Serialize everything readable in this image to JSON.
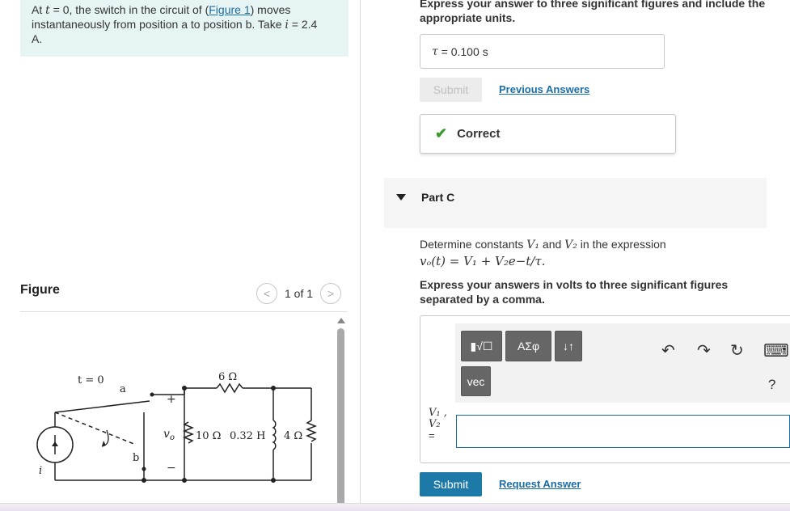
{
  "problem": {
    "p1": "At ",
    "t_var": "t",
    "p2": " = 0, the switch in the circuit of (",
    "link": "Figure 1",
    "p3": ") moves instantaneously from position a to position b. Take ",
    "i_var": "i",
    "p4": " = 2.4",
    "unit": "A."
  },
  "figure": {
    "title": "Figure",
    "pager": "1 of 1",
    "prev": "<",
    "next": ">"
  },
  "circuit": {
    "t_label": "t = 0",
    "a": "a",
    "b": "b",
    "plus": "+",
    "minus": "−",
    "vo": "v",
    "vo_sub": "o",
    "r1": "6 Ω",
    "r2": "10 Ω",
    "l1": "0.32 H",
    "r3": "4 Ω",
    "i": "i"
  },
  "partB": {
    "instruction": "Express your answer to three significant figures and include the appropriate units.",
    "tau_symbol": "τ",
    "eq": " = ",
    "value": "0.100",
    "unit": "s",
    "submit": "Submit",
    "previous": "Previous Answers",
    "correct": "Correct"
  },
  "partC": {
    "label": "Part C",
    "q1": "Determine constants ",
    "v1": "V₁",
    "and": " and ",
    "v2": "V₂",
    "q2": " in the expression",
    "expr": "vₒ(t) = V₁ + V₂e−t/τ.",
    "instruction": "Express your answers in volts to three significant figures separated by a comma.",
    "toolbar": {
      "templates": "▮√☐",
      "greek": "ΑΣφ",
      "arrows": "↓↑",
      "vec": "vec"
    },
    "icons": {
      "undo": "↶",
      "redo": "↷",
      "reset": "↻",
      "keyboard": "⌨",
      "help": "?"
    },
    "var1": "V₁ ,",
    "var2": "V₂",
    "var_eq": "=",
    "input_value": "",
    "submit": "Submit",
    "request": "Request Answer"
  }
}
